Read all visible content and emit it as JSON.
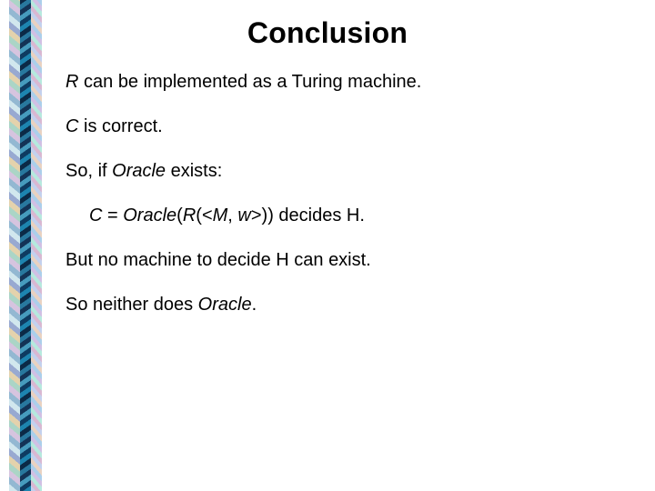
{
  "slide": {
    "title": "Conclusion",
    "lines": {
      "l1_a": "R",
      "l1_b": " can be implemented as a Turing machine.",
      "l2_a": "C",
      "l2_b": " is correct.",
      "l3_a": "So, if ",
      "l3_b": "Oracle",
      "l3_c": " exists:",
      "l4_a": "C",
      "l4_b": " = ",
      "l4_c": "Oracle",
      "l4_d": "(",
      "l4_e": "R",
      "l4_f": "(<",
      "l4_g": "M",
      "l4_h": ", ",
      "l4_i": "w",
      "l4_j": ">)) decides H.",
      "l5": "But no machine to decide H can exist.",
      "l6_a": "So neither does ",
      "l6_b": "Oracle",
      "l6_c": "."
    }
  }
}
